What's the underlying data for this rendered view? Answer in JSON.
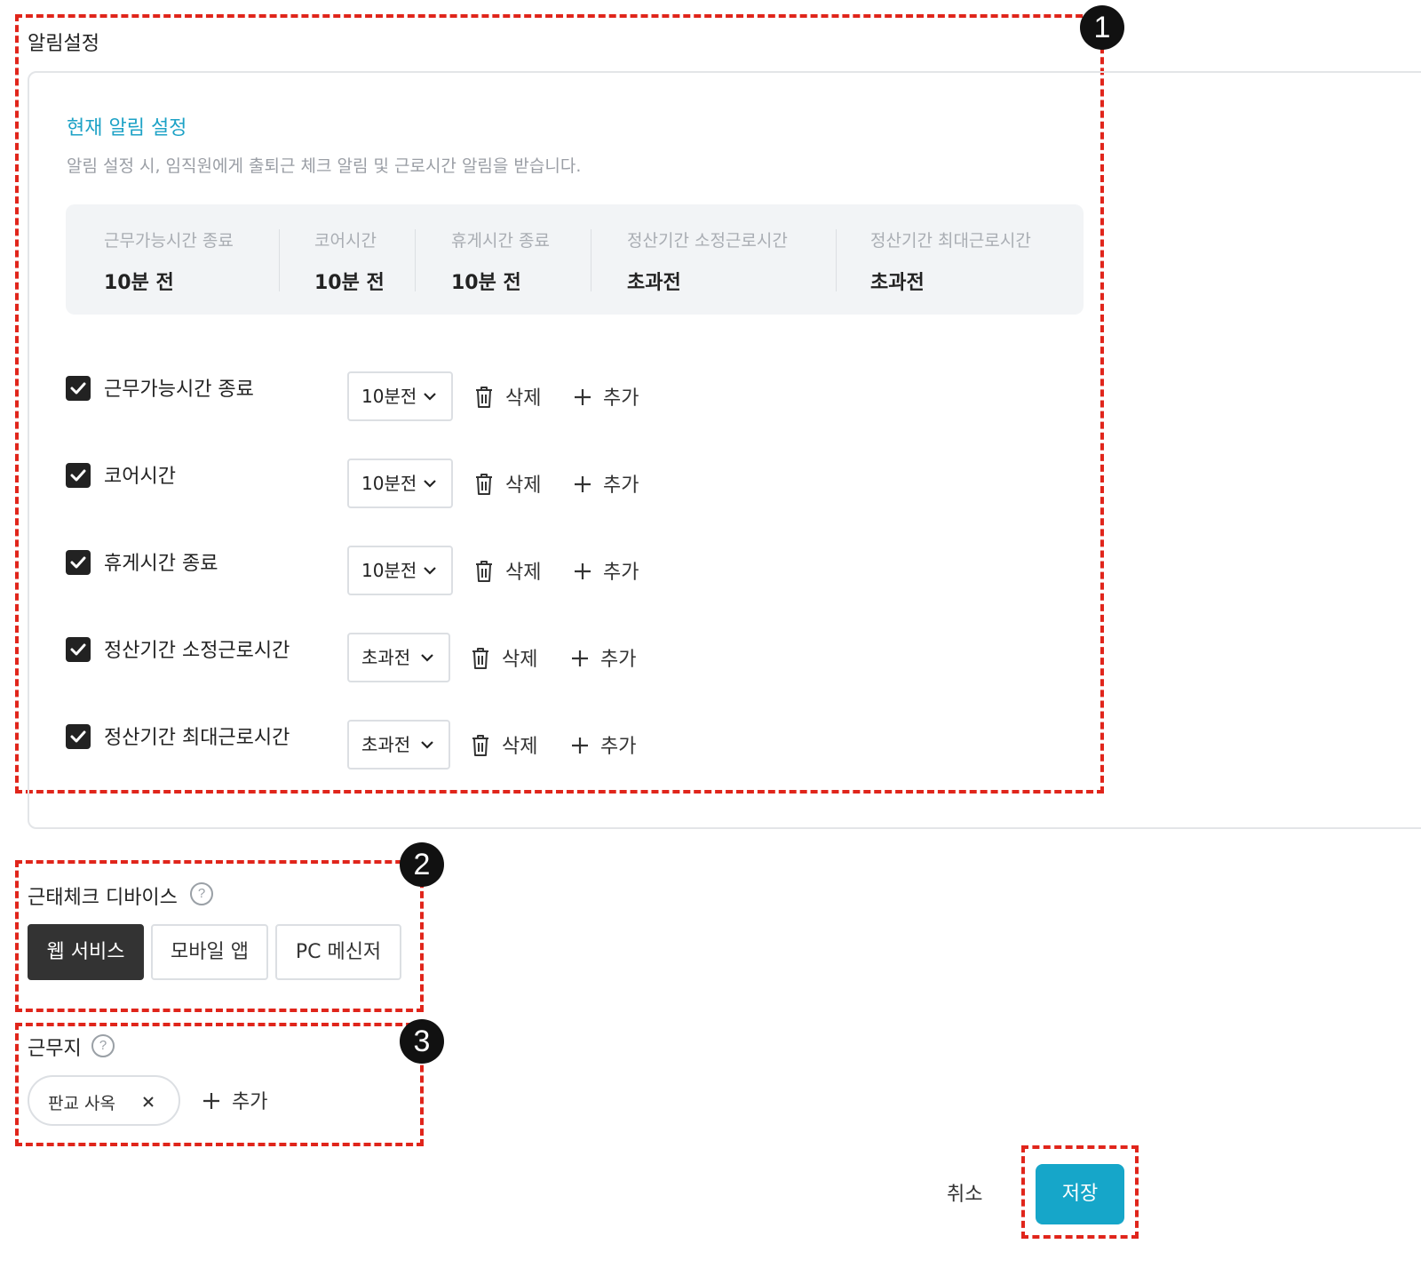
{
  "annotations": {
    "badge1": "1",
    "badge2": "2",
    "badge3": "3",
    "highlight_color": "#e0251b"
  },
  "notification": {
    "section_title": "알림설정",
    "current_title": "현재 알림 설정",
    "current_desc": "알림 설정 시, 임직원에게 출퇴근 체크 알림 및 근로시간 알림을 받습니다.",
    "summary": [
      {
        "label": "근무가능시간 종료",
        "value": "10분 전"
      },
      {
        "label": "코어시간",
        "value": "10분 전"
      },
      {
        "label": "휴게시간 종료",
        "value": "10분 전"
      },
      {
        "label": "정산기간 소정근로시간",
        "value": "초과전"
      },
      {
        "label": "정산기간 최대근로시간",
        "value": "초과전"
      }
    ],
    "rows": [
      {
        "label": "근무가능시간 종료",
        "checked": true,
        "select": "10분전"
      },
      {
        "label": "코어시간",
        "checked": true,
        "select": "10분전"
      },
      {
        "label": "휴게시간 종료",
        "checked": true,
        "select": "10분전"
      },
      {
        "label": "정산기간 소정근로시간",
        "checked": true,
        "select": "초과전"
      },
      {
        "label": "정산기간 최대근로시간",
        "checked": true,
        "select": "초과전"
      }
    ],
    "delete_label": "삭제",
    "add_label": "추가"
  },
  "device": {
    "title": "근태체크 디바이스",
    "help_icon": "question-circle-icon",
    "options": [
      {
        "label": "웹 서비스",
        "selected": true
      },
      {
        "label": "모바일 앱",
        "selected": false
      },
      {
        "label": "PC 메신저",
        "selected": false
      }
    ]
  },
  "workplace": {
    "title": "근무지",
    "help_icon": "question-circle-icon",
    "chips": [
      {
        "label": "판교 사옥"
      }
    ],
    "add_label": "추가"
  },
  "footer": {
    "cancel_label": "취소",
    "save_label": "저장",
    "save_color": "#16a6c9"
  },
  "help_glyph": "?"
}
